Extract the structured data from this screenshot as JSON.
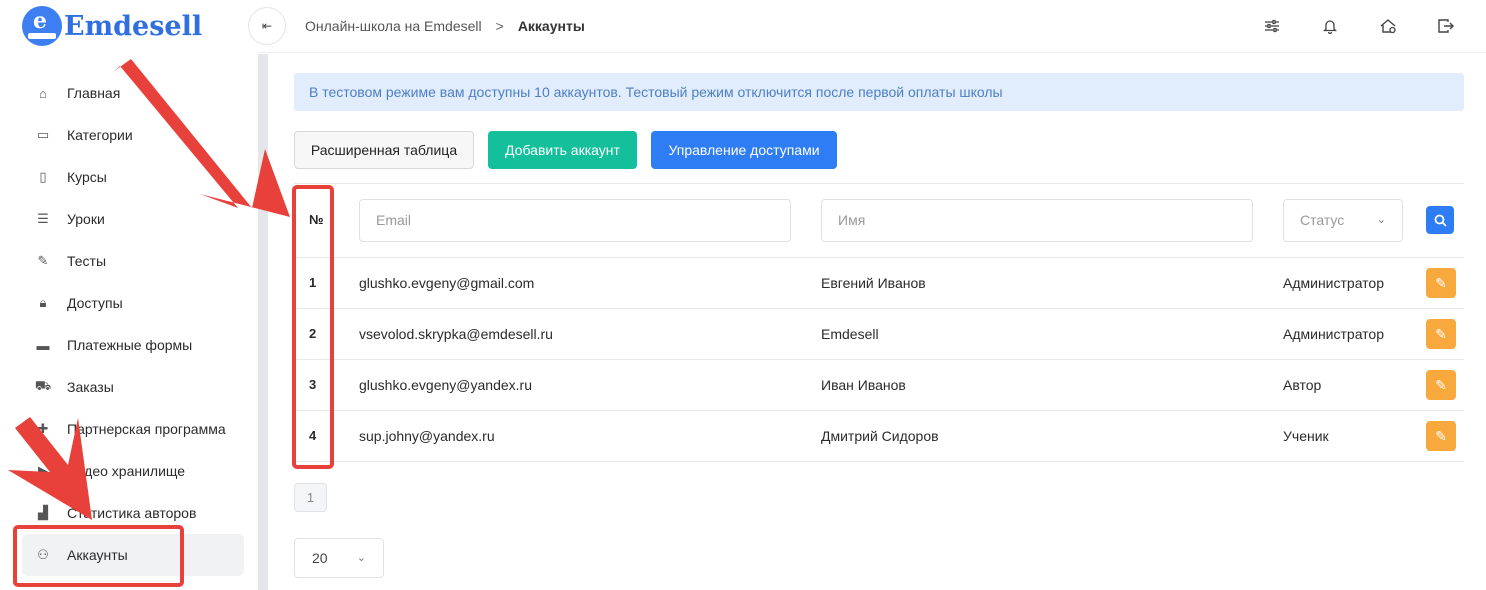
{
  "app": {
    "logo_text": "Emdesell",
    "logo_letter": "e"
  },
  "breadcrumb": {
    "parent": "Онлайн-школа на Emdesell",
    "separator": ">",
    "current": "Аккаунты"
  },
  "sidebar": {
    "items": [
      {
        "label": "Главная",
        "icon": "home-icon",
        "glyph": "⌂"
      },
      {
        "label": "Категории",
        "icon": "folder-icon",
        "glyph": "▭"
      },
      {
        "label": "Курсы",
        "icon": "book-icon",
        "glyph": "▯"
      },
      {
        "label": "Уроки",
        "icon": "list-icon",
        "glyph": "☰"
      },
      {
        "label": "Тесты",
        "icon": "edit-icon",
        "glyph": "✎"
      },
      {
        "label": "Доступы",
        "icon": "lock-icon",
        "glyph": "🔒︎"
      },
      {
        "label": "Платежные формы",
        "icon": "credit-card-icon",
        "glyph": "▬"
      },
      {
        "label": "Заказы",
        "icon": "cart-icon",
        "glyph": "⛟"
      },
      {
        "label": "Партнерская программа",
        "icon": "gift-icon",
        "glyph": "✚"
      },
      {
        "label": "Видео хранилище",
        "icon": "video-icon",
        "glyph": "▶"
      },
      {
        "label": "Статистика авторов",
        "icon": "bar-chart-icon",
        "glyph": "▟"
      },
      {
        "label": "Аккаунты",
        "icon": "users-icon",
        "glyph": "⚇",
        "active": true
      }
    ]
  },
  "alert": {
    "text": "В тестовом режиме вам доступны 10 аккаунтов. Тестовый режим отключится после первой оплаты школы"
  },
  "toolbar": {
    "extended_table": "Расширенная таблица",
    "add_account": "Добавить аккаунт",
    "manage_access": "Управление доступами"
  },
  "table": {
    "no_header": "№",
    "email_placeholder": "Email",
    "name_placeholder": "Имя",
    "status_placeholder": "Статус",
    "rows": [
      {
        "no": "1",
        "email": "glushko.evgeny@gmail.com",
        "name": "Евгений Иванов",
        "role": "Администратор"
      },
      {
        "no": "2",
        "email": "vsevolod.skrypka@emdesell.ru",
        "name": "Emdesell",
        "role": "Администратор"
      },
      {
        "no": "3",
        "email": "glushko.evgeny@yandex.ru",
        "name": "Иван Иванов",
        "role": "Автор"
      },
      {
        "no": "4",
        "email": "sup.johny@yandex.ru",
        "name": "Дмитрий Сидоров",
        "role": "Ученик"
      }
    ]
  },
  "pagination": {
    "current_page": "1",
    "per_page": "20"
  },
  "colors": {
    "accent": "#2f7df4",
    "success": "#13c09b",
    "warning": "#f8a93d",
    "annotation": "#e8403a",
    "alert_bg": "#e1edfd"
  }
}
